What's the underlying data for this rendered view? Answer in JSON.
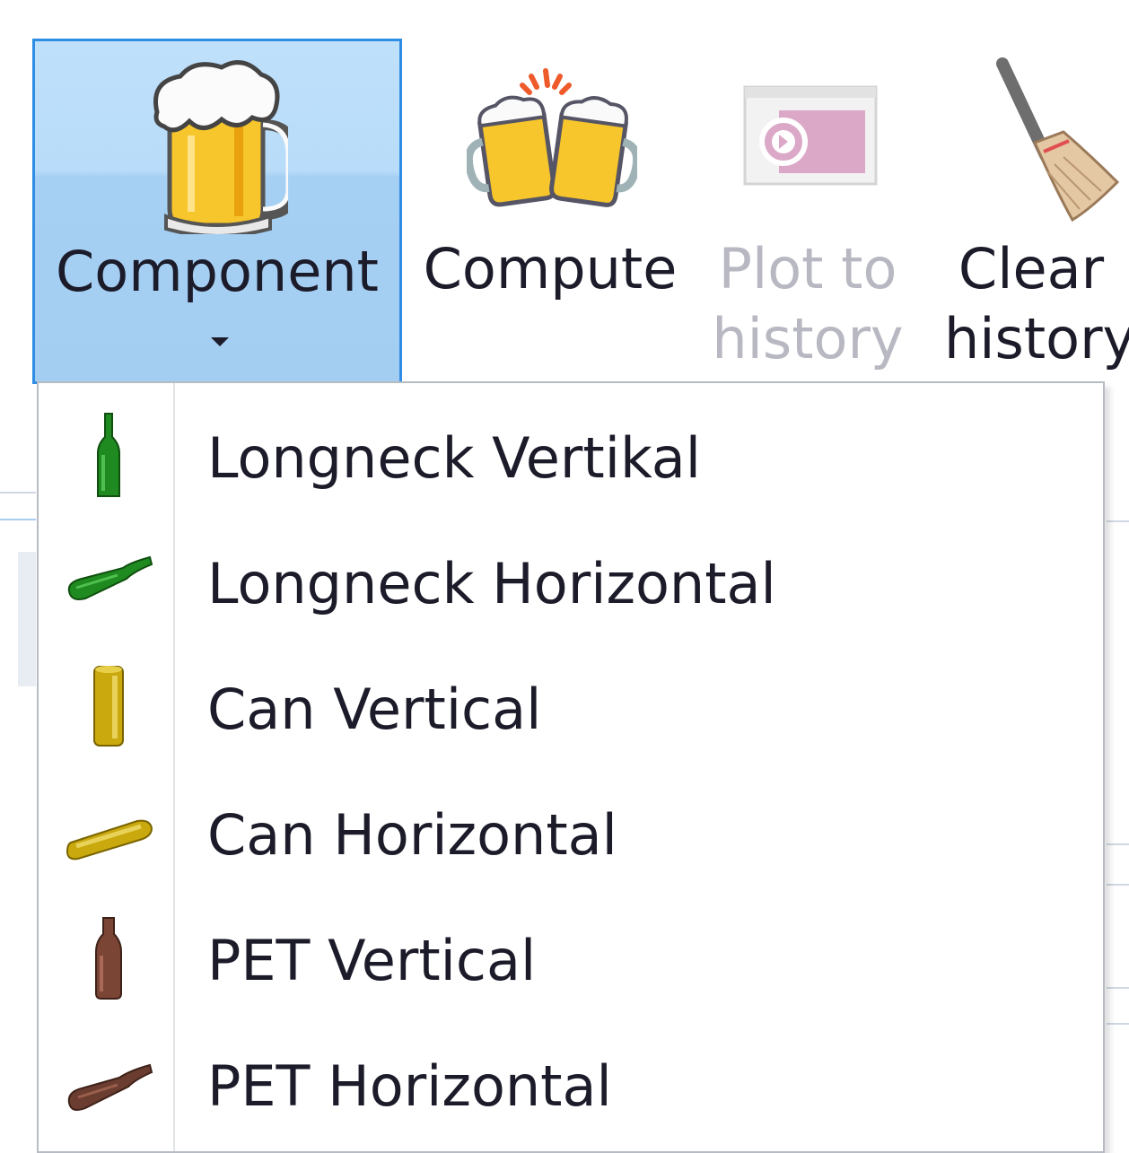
{
  "ribbon": {
    "buttons": [
      {
        "id": "component",
        "label": "Component",
        "icon": "beer-mug-icon",
        "state": "pressed",
        "has_dropdown": true
      },
      {
        "id": "compute",
        "label": "Compute",
        "icon": "beer-cheers-icon",
        "state": "normal"
      },
      {
        "id": "plot_to_history",
        "label_line1": "Plot to",
        "label_line2": "history",
        "icon": "plot-to-history-icon",
        "state": "disabled"
      },
      {
        "id": "clear_history",
        "label_line1": "Clear",
        "label_line2": "history",
        "icon": "broom-icon",
        "state": "normal"
      }
    ]
  },
  "component_menu": {
    "items": [
      {
        "label": "Longneck Vertikal",
        "icon": "longneck-vertical-icon",
        "color": "#1f8a1f"
      },
      {
        "label": "Longneck Horizontal",
        "icon": "longneck-horizontal-icon",
        "color": "#1f8a1f"
      },
      {
        "label": "Can Vertical",
        "icon": "can-vertical-icon",
        "color": "#c9a90e"
      },
      {
        "label": "Can Horizontal",
        "icon": "can-horizontal-icon",
        "color": "#c9a90e"
      },
      {
        "label": "PET Vertical",
        "icon": "pet-vertical-icon",
        "color": "#7a4535"
      },
      {
        "label": "PET Horizontal",
        "icon": "pet-horizontal-icon",
        "color": "#6b3d30"
      }
    ]
  },
  "colors": {
    "pressed_fill": "#b8dcf9",
    "pressed_border": "#2f8de4",
    "text": "#1b1b2a",
    "disabled_text": "#b8b8c2"
  }
}
